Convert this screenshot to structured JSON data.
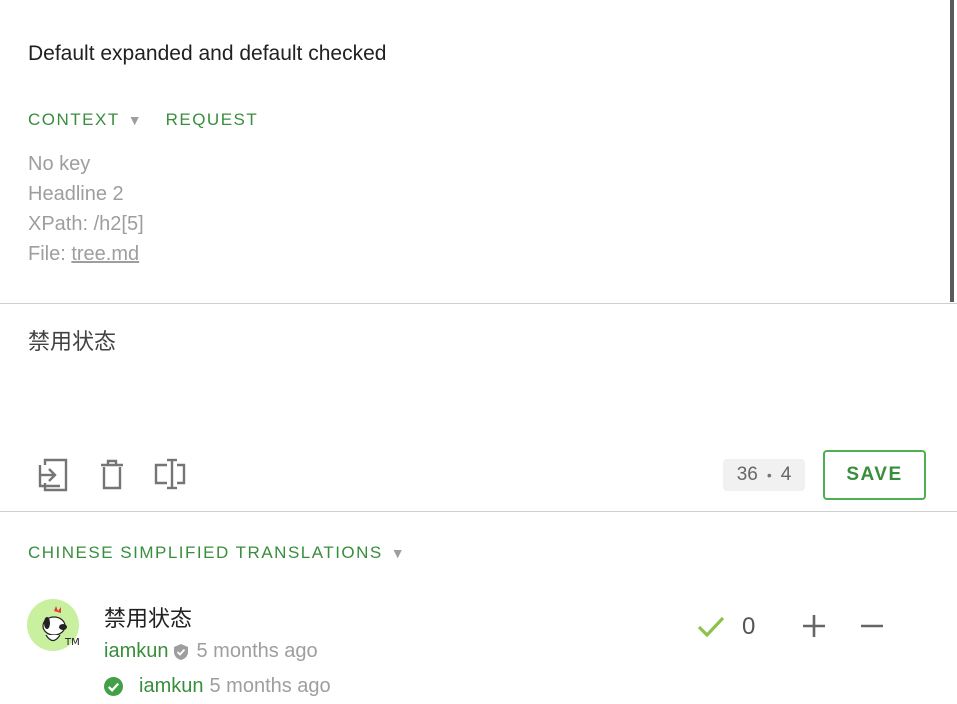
{
  "source": {
    "text": "Default expanded and default checked"
  },
  "tabs": {
    "context": "CONTEXT",
    "request": "REQUEST"
  },
  "context": {
    "key": "No key",
    "headline": "Headline 2",
    "xpath": "XPath: /h2[5]",
    "file_label": "File: ",
    "file_link": "tree.md"
  },
  "translation": {
    "text": "禁用状态",
    "counter_chars": "36",
    "counter_sep": "•",
    "counter_words": "4",
    "save_label": "SAVE"
  },
  "toolbar": {
    "icons": [
      "copy-source-icon",
      "delete-icon",
      "insert-placeholder-icon"
    ]
  },
  "suggestions": {
    "title": "CHINESE SIMPLIFIED TRANSLATIONS",
    "items": [
      {
        "text": "禁用状态",
        "author": "iamkun",
        "time": "5 months ago",
        "approver": "iamkun",
        "approved_time": "5 months ago",
        "votes": "0"
      }
    ]
  },
  "colors": {
    "accent": "#388e3c",
    "muted": "#9e9e9e",
    "approved": "#43a047"
  }
}
